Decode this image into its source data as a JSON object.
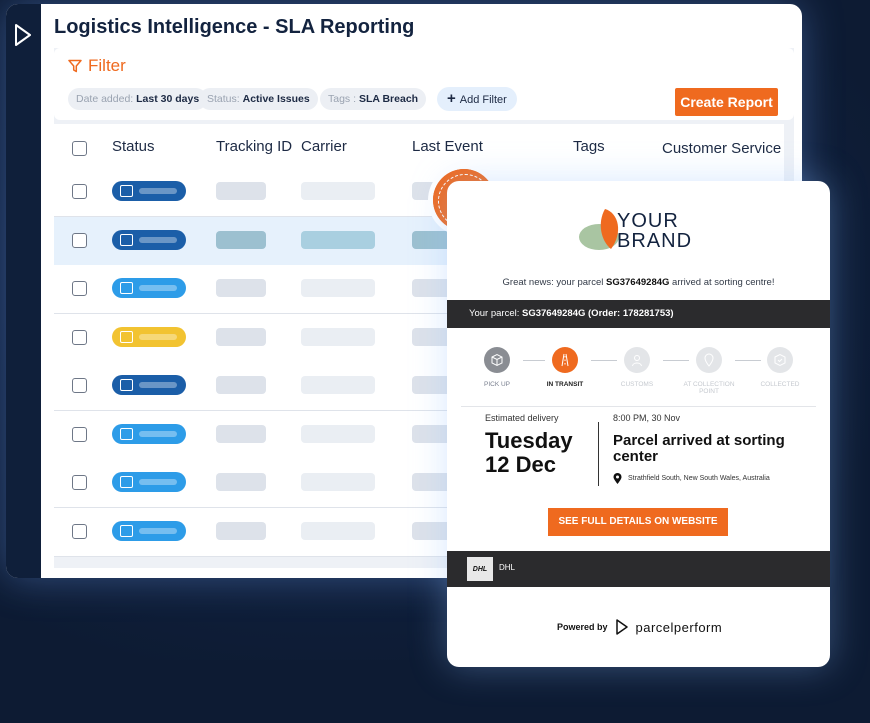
{
  "app": {
    "title": "Logistics Intelligence - SLA Reporting"
  },
  "filter": {
    "title": "Filter",
    "chips": [
      {
        "key": "Date added:",
        "value": "Last 30 days"
      },
      {
        "key": "Status:",
        "value": "Active Issues"
      },
      {
        "key": "Tags :",
        "value": "SLA Breach"
      }
    ],
    "add_label": "Add Filter",
    "create_report_label": "Create Report"
  },
  "table": {
    "columns": [
      "Status",
      "Tracking ID",
      "Carrier",
      "Last Event",
      "Tags",
      "Customer Service"
    ],
    "rows": [
      {
        "status_color": "#1b5ea8",
        "icon": "parcel-clock-icon",
        "selected": false
      },
      {
        "status_color": "#1b5ea8",
        "icon": "parcel-clock-icon",
        "selected": true
      },
      {
        "status_color": "#2d9ce8",
        "icon": "truck-icon",
        "selected": false
      },
      {
        "status_color": "#f2c331",
        "icon": "parcel-warning-icon",
        "selected": false
      },
      {
        "status_color": "#1b5ea8",
        "icon": "parcel-clock-icon",
        "selected": false
      },
      {
        "status_color": "#2d9ce8",
        "icon": "return-arrow-icon",
        "selected": false
      },
      {
        "status_color": "#2d9ce8",
        "icon": "truck-icon",
        "selected": false
      },
      {
        "status_color": "#2d9ce8",
        "icon": "truck-icon",
        "selected": false
      }
    ]
  },
  "email": {
    "brand_line1": "YOUR",
    "brand_line2": "BRAND",
    "great_news_prefix": "Great news: your parcel ",
    "tracking_number": "SG37649284G",
    "great_news_suffix": " arrived at sorting centre!",
    "parcel_prefix": "Your parcel: ",
    "parcel_detail": "SG37649284G (Order: 178281753)",
    "steps": [
      {
        "label": "PICK UP",
        "state": "done"
      },
      {
        "label": "IN TRANSIT",
        "state": "active"
      },
      {
        "label": "CUSTOMS",
        "state": "pending"
      },
      {
        "label": "AT COLLECTION POINT",
        "state": "pending"
      },
      {
        "label": "COLLECTED",
        "state": "pending"
      }
    ],
    "estimated_label": "Estimated delivery",
    "estimated_day": "Tuesday",
    "estimated_date": "12 Dec",
    "event_time": "8:00 PM, 30 Nov",
    "event_title": "Parcel arrived at sorting center",
    "event_location": "Strathfield South, New South Wales, Australia",
    "cta_label": "SEE FULL DETAILS ON WEBSITE",
    "carrier_logo_text": "DHL",
    "carrier_name": "DHL",
    "powered_by": "Powered by",
    "powered_brand": "parcelperform"
  },
  "colors": {
    "accent": "#ef6a1f",
    "navy": "#0f1f3a"
  }
}
